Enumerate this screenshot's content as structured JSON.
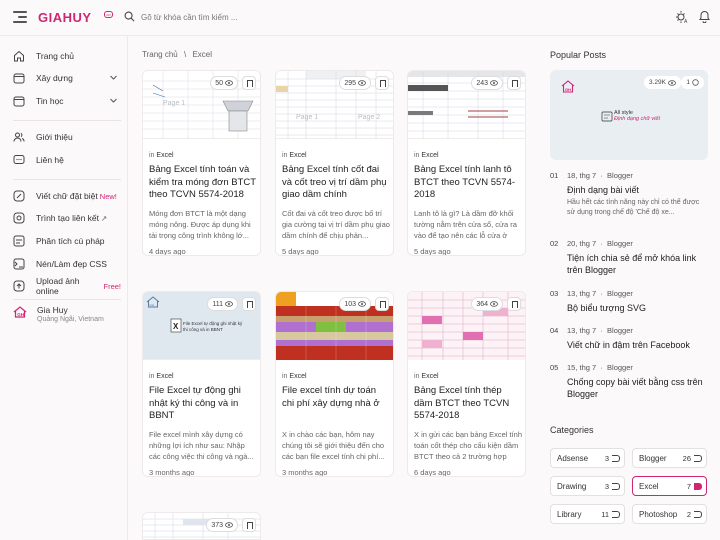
{
  "brand": {
    "logo_text": "GIAHUY",
    "badge": "co"
  },
  "search": {
    "placeholder": "Gõ từ khóa cần tìm kiếm ..."
  },
  "sidebar": {
    "items": [
      {
        "label": "Trang chủ",
        "icon": "home-icon"
      },
      {
        "label": "Xây dựng",
        "icon": "folder-icon",
        "expandable": true
      },
      {
        "label": "Tin học",
        "icon": "folder-icon",
        "expandable": true
      },
      {
        "label": "Giới thiệu",
        "icon": "people-icon"
      },
      {
        "label": "Liên hệ",
        "icon": "chat-icon"
      },
      {
        "label": "Viết chữ đặt biệt",
        "badge": "New!",
        "icon": "edit-icon"
      },
      {
        "label": "Trình tạo liên kết",
        "badge": "↗",
        "icon": "link-icon"
      },
      {
        "label": "Phân tích cú pháp",
        "icon": "parse-icon"
      },
      {
        "label": "Nén/Làm đẹp CSS",
        "icon": "css-icon"
      },
      {
        "label": "Upload ảnh online",
        "badge": "Free!",
        "icon": "upload-icon"
      }
    ],
    "profile": {
      "name": "Gia Huy",
      "location": "Quảng Ngãi, Vietnam"
    }
  },
  "breadcrumb": {
    "home": "Trang chủ",
    "sep": "\\",
    "current": "Excel"
  },
  "posts": [
    {
      "views": "50",
      "prefix": "in",
      "label": "Excel",
      "title": "Bảng Excel tính toán và kiểm tra móng đơn BTCT theo TCVN 5574-2018",
      "snippet": "Móng đơn BTCT là một dạng móng nông. Được áp dụng khi tải trọng công trình không lớ...",
      "date": "4 days ago",
      "thumb": "sheet"
    },
    {
      "views": "295",
      "prefix": "in",
      "label": "Excel",
      "title": "Bảng Excel tính cốt đai và cốt treo vị trí dầm phụ giao dầm chính",
      "snippet": "Cốt đai và cốt treo được bố trí gia cường tại vị trí dầm phụ giao dầm chính để chịu phản...",
      "date": "5 days ago",
      "thumb": "sheet"
    },
    {
      "views": "243",
      "prefix": "in",
      "label": "Excel",
      "title": "Bảng Excel tính lanh tô BTCT theo TCVN 5574-2018",
      "snippet": "Lanh tô là gì? Là dầm đỡ khối tường nằm trên cửa sổ, cửa ra vào để tạo nên các lỗ cửa ở bê...",
      "date": "5 days ago",
      "thumb": "sheet"
    },
    {
      "views": "111",
      "prefix": "in",
      "label": "Excel",
      "title": "File Excel tự động ghi nhật ký thi công và in BBNT",
      "snippet": "File excel mình xây dựng có những lợi ích như sau: Nhập các công việc thi công và ngà...",
      "date": "3 months ago",
      "thumb": "logo",
      "thumb_text": "File Excel tự động ghi nhật ký thi công và in BBNT"
    },
    {
      "views": "103",
      "prefix": "in",
      "label": "Excel",
      "title": "File excel tính dự toán chi phí xây dựng nhà ở",
      "snippet": "X in chào các bạn, hôm nay chúng tôi sẽ giới thiệu đến cho các bạn file excel tính chi phí...",
      "date": "3 months ago",
      "thumb": "red"
    },
    {
      "views": "364",
      "prefix": "in",
      "label": "Excel",
      "title": "Bảng Excel tính thép dầm BTCT theo TCVN 5574-2018",
      "snippet": "X in gửi các bạn bảng Excel tính toán cốt thép cho cấu kiện dầm BTCT theo cả 2 trường hợp dầ...",
      "date": "6 days ago",
      "thumb": "pink"
    },
    {
      "views": "373",
      "thumb": "sheet"
    }
  ],
  "popular": {
    "heading": "Popular Posts",
    "image_views": "3.29K",
    "image_comments": "1",
    "image_text": [
      "All style",
      "Định dạng chữ viết"
    ],
    "items": [
      {
        "num": "01",
        "date": "18, thg 7",
        "author": "Blogger",
        "title": "Định dạng bài viết",
        "snippet": "Hầu hết các tính năng này chỉ có thể được sử dụng trong chế độ 'Chế độ xe..."
      },
      {
        "num": "02",
        "date": "20, thg 7",
        "author": "Blogger",
        "title": "Tiện ích chia sẻ để mở khóa link trên Blogger"
      },
      {
        "num": "03",
        "date": "13, thg 7",
        "author": "Blogger",
        "title": "Bộ biểu tượng SVG"
      },
      {
        "num": "04",
        "date": "13, thg 7",
        "author": "Blogger",
        "title": "Viết chữ in đậm trên Facebook"
      },
      {
        "num": "05",
        "date": "15, thg 7",
        "author": "Blogger",
        "title": "Chống copy bài viết bằng css trên Blogger"
      }
    ]
  },
  "categories": {
    "heading": "Categories",
    "items": [
      {
        "name": "Adsense",
        "count": "3"
      },
      {
        "name": "Blogger",
        "count": "26"
      },
      {
        "name": "Drawing",
        "count": "3"
      },
      {
        "name": "Excel",
        "count": "7",
        "active": true
      },
      {
        "name": "Library",
        "count": "11"
      },
      {
        "name": "Photoshop",
        "count": "2"
      }
    ]
  },
  "colors": {
    "accent": "#cf2674",
    "background": "#fbf9f9"
  }
}
